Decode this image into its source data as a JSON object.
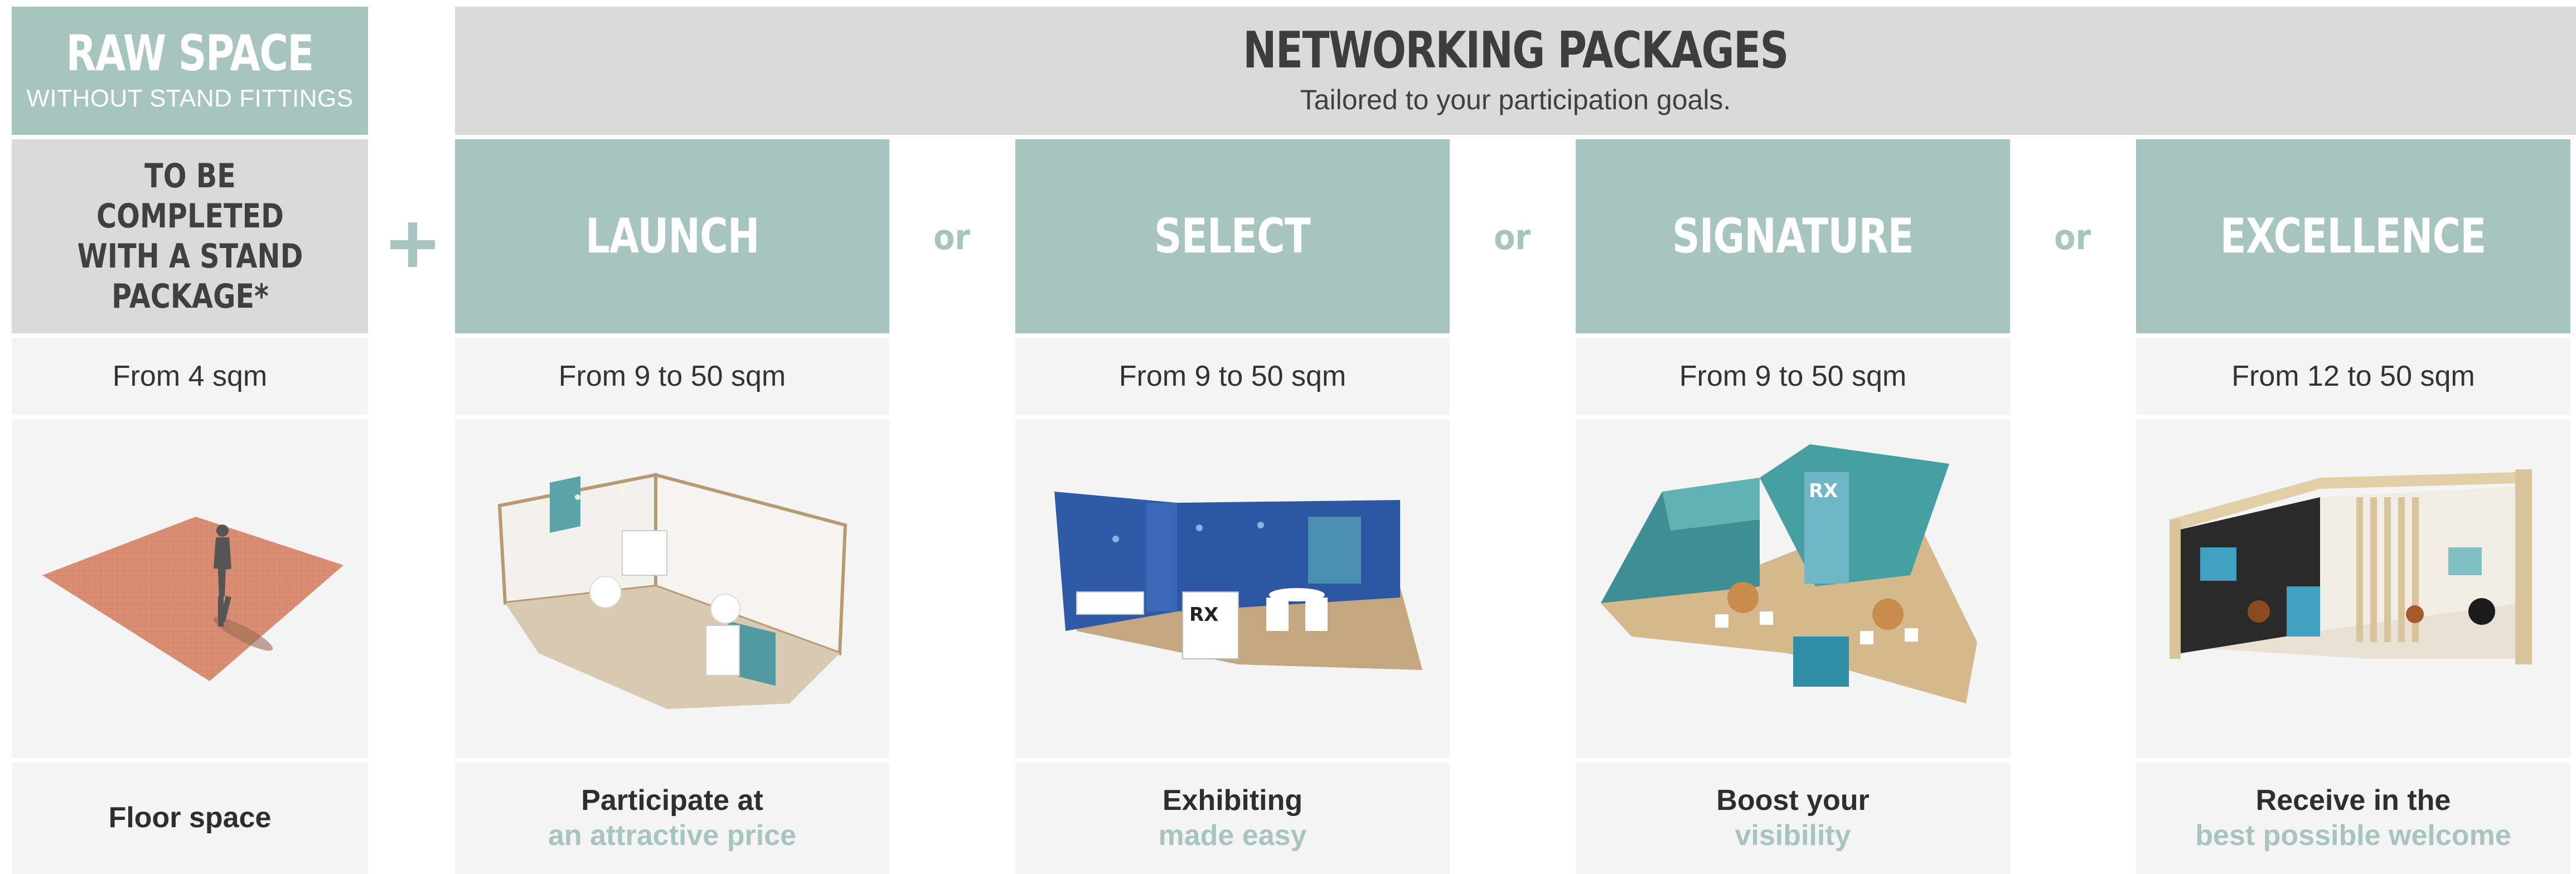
{
  "raw_space": {
    "header_title": "RAW SPACE",
    "header_subtitle": "WITHOUT STAND FITTINGS",
    "title": "TO BE COMPLETED WITH A STAND PACKAGE*",
    "size": "From 4 sqm",
    "desc_line1": "Floor space",
    "image_icon": "floor-plan-illustration"
  },
  "networking": {
    "header_title": "NETWORKING PACKAGES",
    "header_subtitle": "Tailored to your participation goals."
  },
  "separators": {
    "plus": "+",
    "or": "or"
  },
  "packages": [
    {
      "title": "LAUNCH",
      "size": "From 9 to 50 sqm",
      "desc_line1": "Participate at",
      "desc_line2": "an attractive price",
      "image_icon": "launch-stand-illustration"
    },
    {
      "title": "SELECT",
      "size": "From 9 to 50 sqm",
      "desc_line1": "Exhibiting",
      "desc_line2": "made easy",
      "image_icon": "select-stand-illustration",
      "logo_text": "RX"
    },
    {
      "title": "SIGNATURE",
      "size": "From 9 to 50 sqm",
      "desc_line1": "Boost your",
      "desc_line2": "visibility",
      "image_icon": "signature-stand-illustration",
      "logo_text": "RX"
    },
    {
      "title": "EXCELLENCE",
      "size": "From 12 to 50 sqm",
      "desc_line1": "Receive in the",
      "desc_line2": "best possible welcome",
      "image_icon": "excellence-stand-illustration"
    }
  ],
  "colors": {
    "accent": "#a8c4bf",
    "header_grey": "#dadada",
    "cell_bg": "#f4f4f4",
    "text_dark": "#333333"
  }
}
